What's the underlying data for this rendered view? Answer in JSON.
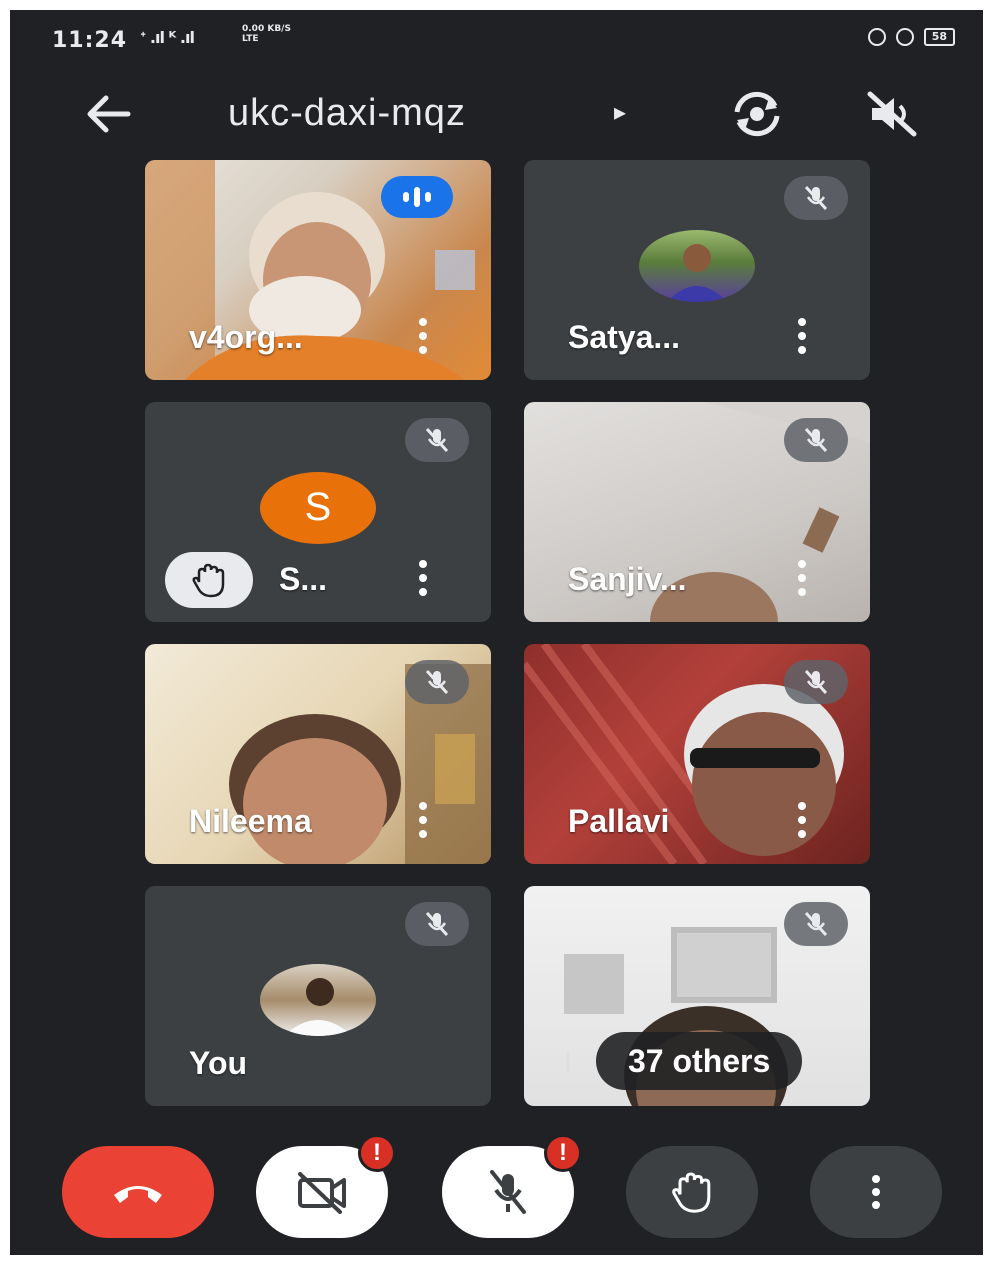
{
  "status_bar": {
    "time": "11:24",
    "signal": "ᐩ .ıl ᴷ .ıl",
    "data_rate": "0.00 KB/S",
    "network": "LTE",
    "battery": "58"
  },
  "app_bar": {
    "meeting_code": "ukc-daxi-mqz",
    "caret": "▸"
  },
  "participants": [
    {
      "name": "v4org...",
      "speaking": true
    },
    {
      "name": "Satya...",
      "muted": true
    },
    {
      "name": "S...",
      "avatar_letter": "S",
      "hand_raised": true,
      "muted": true
    },
    {
      "name": "Sanjiv...",
      "muted": true
    },
    {
      "name": "Nileema",
      "muted": true
    },
    {
      "name": "Pallavi",
      "muted": true
    },
    {
      "name": "You",
      "muted": true
    },
    {
      "name": "I",
      "others_label": "37 others",
      "muted": true
    }
  ],
  "colors": {
    "background": "#202124",
    "tile": "#3c4043",
    "end_call": "#ea4335",
    "speaking": "#1a73e8",
    "avatar_orange": "#e8710a",
    "alert": "#d93025"
  },
  "controls": {
    "alert_mark": "!"
  }
}
